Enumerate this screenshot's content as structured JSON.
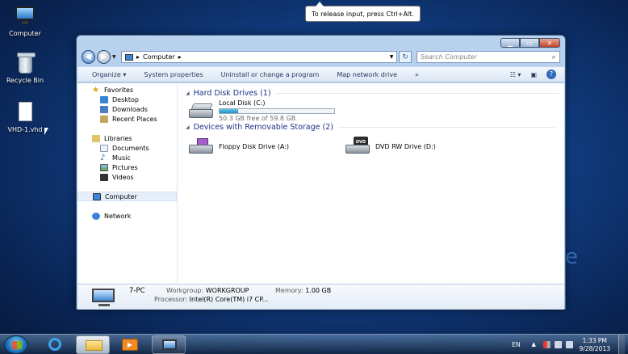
{
  "desktop": {
    "icons": [
      {
        "label": "Computer"
      },
      {
        "label": "Recycle Bin"
      },
      {
        "label": "VHD-1.vhd"
      }
    ],
    "watermark": "e"
  },
  "tooltip": {
    "text": "To release input, press Ctrl+Alt."
  },
  "window": {
    "address": {
      "path_segment": "Computer"
    },
    "search": {
      "placeholder": "Search Computer"
    },
    "toolbar": {
      "organize": "Organize",
      "system_properties": "System properties",
      "uninstall": "Uninstall or change a program",
      "map_drive": "Map network drive",
      "more": "»",
      "help": "?"
    },
    "nav": {
      "favorites": "Favorites",
      "desktop": "Desktop",
      "downloads": "Downloads",
      "recent": "Recent Places",
      "libraries": "Libraries",
      "documents": "Documents",
      "music": "Music",
      "pictures": "Pictures",
      "videos": "Videos",
      "computer": "Computer",
      "network": "Network"
    },
    "groups": {
      "hdd_header": "Hard Disk Drives (1)",
      "removable_header": "Devices with Removable Storage (2)"
    },
    "drives": {
      "local": {
        "name": "Local Disk (C:)",
        "free": "50.3 GB free of 59.8 GB",
        "used_fraction": 0.16
      },
      "floppy": {
        "name": "Floppy Disk Drive (A:)"
      },
      "dvd": {
        "name": "DVD RW Drive (D:)",
        "icon_text": "DVD"
      }
    },
    "details": {
      "name": "7-PC",
      "workgroup_label": "Workgroup:",
      "workgroup_value": "WORKGROUP",
      "memory_label": "Memory:",
      "memory_value": "1.00 GB",
      "processor_label": "Processor:",
      "processor_value": "Intel(R) Core(TM) i7 CP..."
    }
  },
  "taskbar": {
    "language": "EN",
    "time": "1:33 PM",
    "date": "9/28/2013"
  }
}
